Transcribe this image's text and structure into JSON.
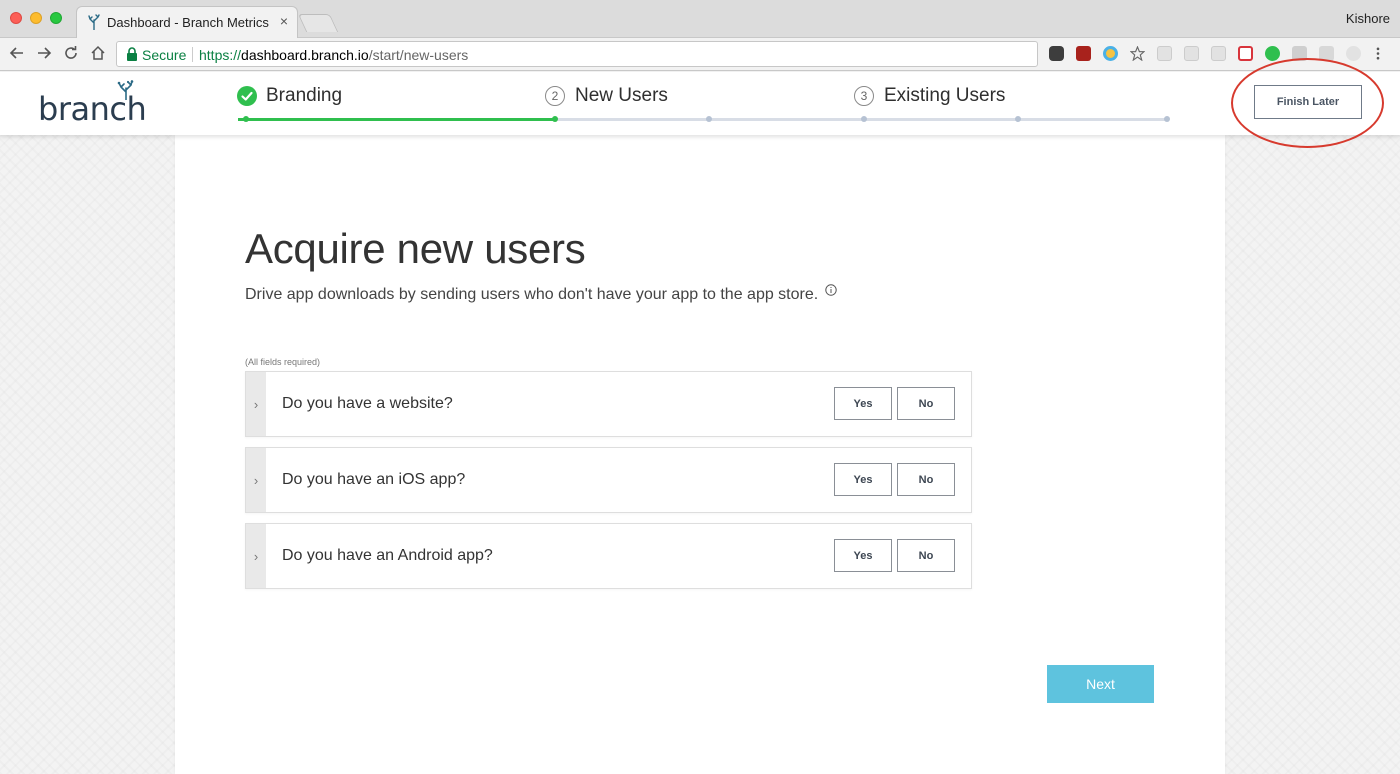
{
  "browser": {
    "tab_title": "Dashboard - Branch Metrics",
    "tab_close": "×",
    "profile_name": "Kishore",
    "secure_label": "Secure",
    "url_scheme": "https://",
    "url_host": "dashboard.branch.io",
    "url_path": "/start/new-users",
    "nav_icons": [
      "back-icon",
      "forward-icon",
      "reload-icon",
      "home-icon"
    ],
    "extension_icons": [
      "evernote-icon",
      "ublock-icon",
      "clock-icon",
      "star-icon",
      "ext-chart-icon",
      "ext-message-icon",
      "ext-pen-icon",
      "ext-plus-icon",
      "ext-play-icon",
      "ext-g-icon",
      "ext-tag-icon",
      "ext-gray-icon",
      "menu-icon"
    ]
  },
  "header": {
    "logo": "branch",
    "steps": [
      {
        "number": "",
        "label": "Branding",
        "status": "complete"
      },
      {
        "number": "2",
        "label": "New Users",
        "status": "current"
      },
      {
        "number": "3",
        "label": "Existing Users",
        "status": "upcoming"
      }
    ],
    "progress_fraction": 0.34,
    "finish_later_label": "Finish Later"
  },
  "main": {
    "title": "Acquire new users",
    "subtitle": "Drive app downloads by sending users who don't have your app to the app store.",
    "fields_note": "(All fields required)",
    "questions": [
      {
        "text": "Do you have a website?",
        "yes_label": "Yes",
        "no_label": "No"
      },
      {
        "text": "Do you have an iOS app?",
        "yes_label": "Yes",
        "no_label": "No"
      },
      {
        "text": "Do you have an Android app?",
        "yes_label": "Yes",
        "no_label": "No"
      }
    ],
    "next_label": "Next"
  },
  "colors": {
    "accent_green": "#2fbf4e",
    "next_button": "#5ec3de",
    "annotation_red": "#d73a2e",
    "secure_green": "#0b8043"
  }
}
